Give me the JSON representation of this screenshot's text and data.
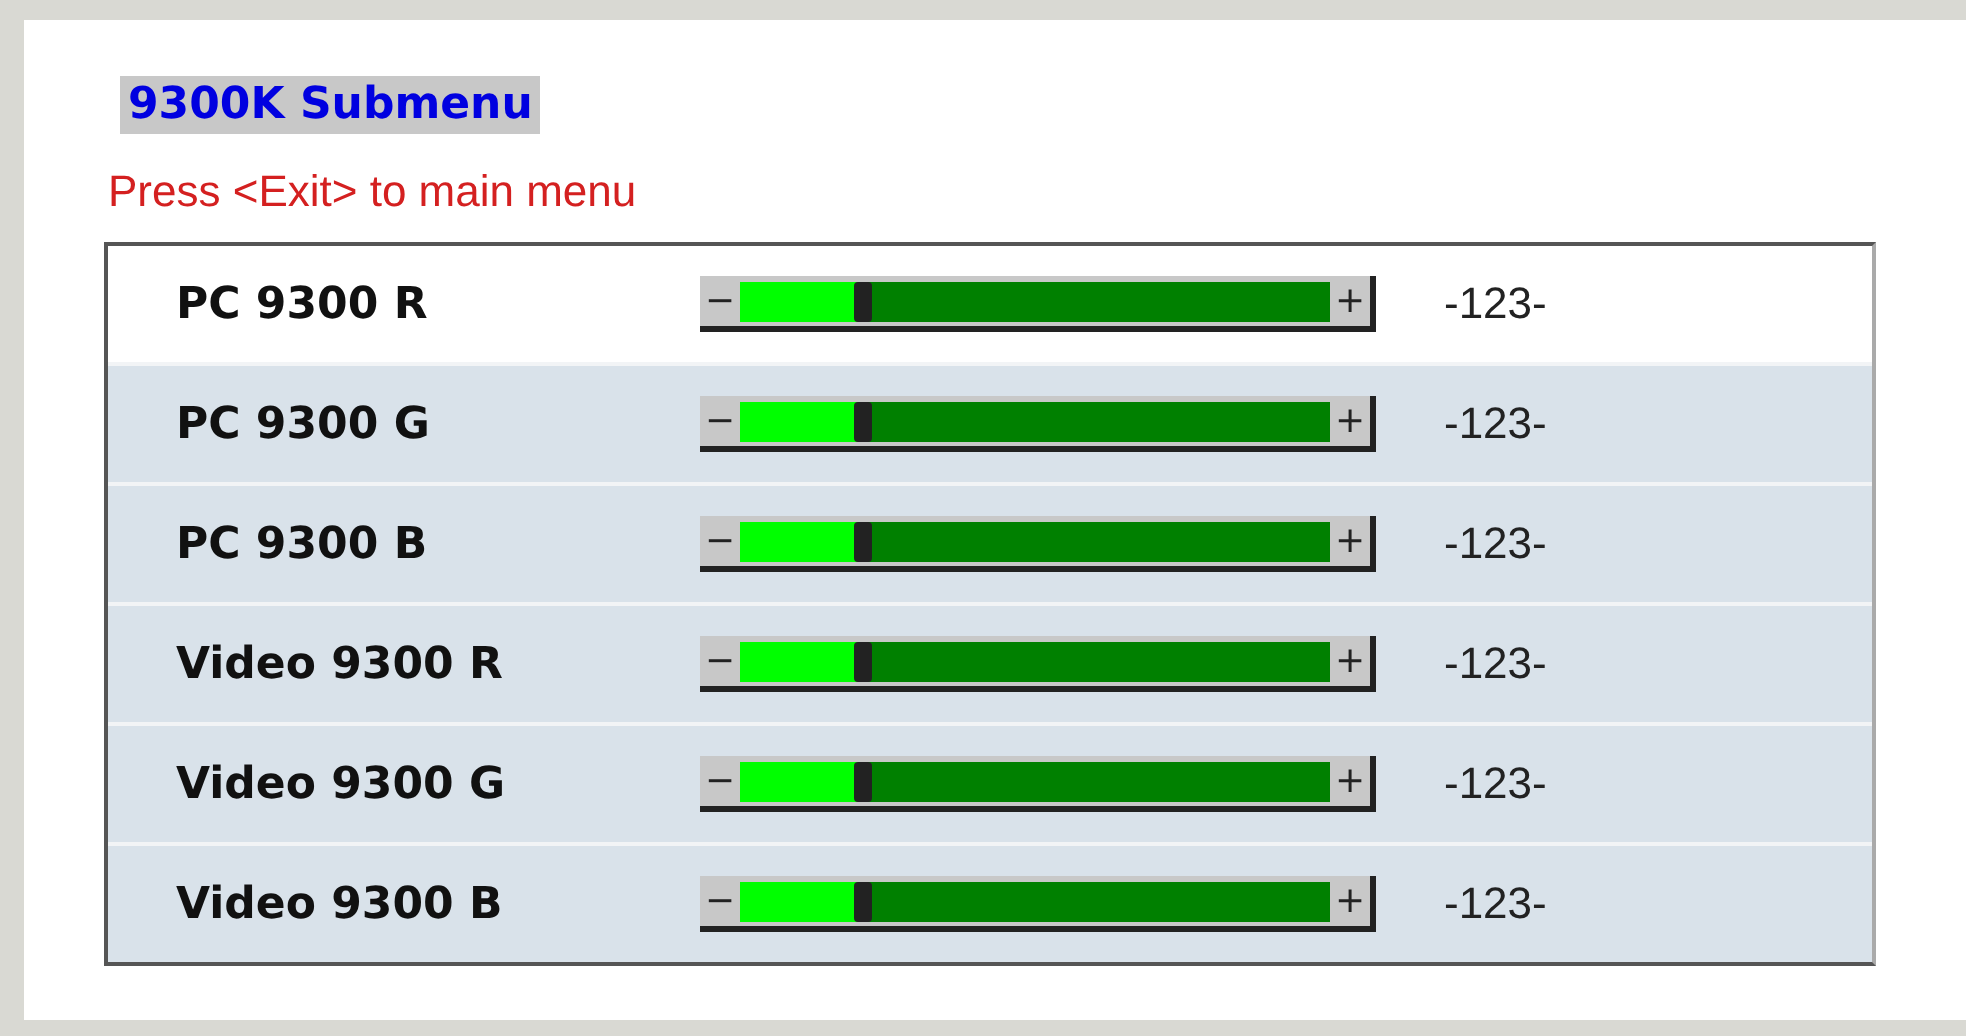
{
  "title": "9300K Submenu",
  "hint": "Press <Exit> to main menu",
  "rows": [
    {
      "label": "PC 9300 R",
      "selected": true,
      "level": 0.2,
      "decrease": "−",
      "increase": "+",
      "reading": "-123-"
    },
    {
      "label": "PC 9300 G",
      "selected": false,
      "level": 0.2,
      "decrease": "−",
      "increase": "+",
      "reading": "-123-"
    },
    {
      "label": "PC 9300 B",
      "selected": false,
      "level": 0.2,
      "decrease": "−",
      "increase": "+",
      "reading": "-123-"
    },
    {
      "label": "Video 9300 R",
      "selected": false,
      "level": 0.2,
      "decrease": "−",
      "increase": "+",
      "reading": "-123-"
    },
    {
      "label": "Video 9300 G",
      "selected": false,
      "level": 0.2,
      "decrease": "−",
      "increase": "+",
      "reading": "-123-"
    },
    {
      "label": "Video 9300 B",
      "selected": false,
      "level": 0.2,
      "decrease": "−",
      "increase": "+",
      "reading": "-123-"
    }
  ]
}
